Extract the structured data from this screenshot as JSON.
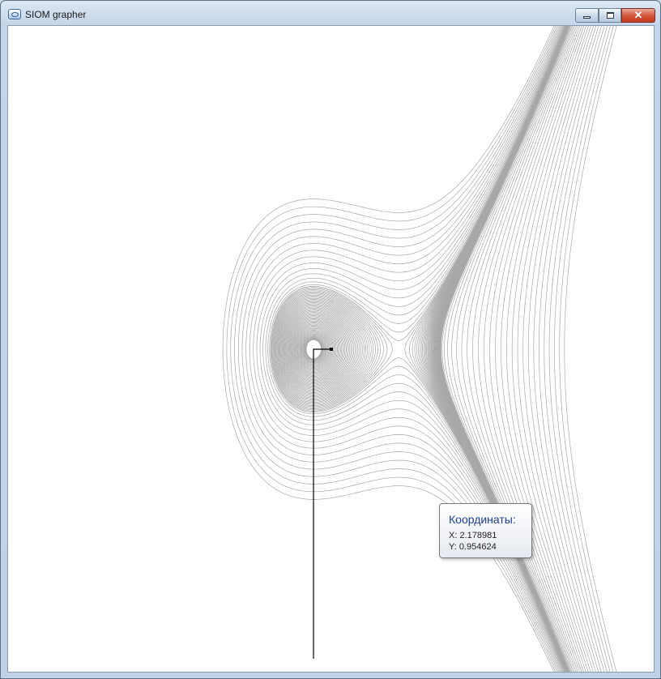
{
  "window": {
    "title": "SIOM grapher",
    "icon": "app-icon",
    "controls": {
      "minimize": "minimize-icon",
      "maximize": "maximize-icon",
      "close": "close-icon"
    }
  },
  "tooltip": {
    "title": "Координаты:",
    "x_line": "X: 2.178981",
    "y_line": "Y: 0.954624"
  },
  "colors": {
    "curve": "#a8a8a8",
    "trajectory": "#000000",
    "tooltip_title": "#1f3f8f"
  }
}
